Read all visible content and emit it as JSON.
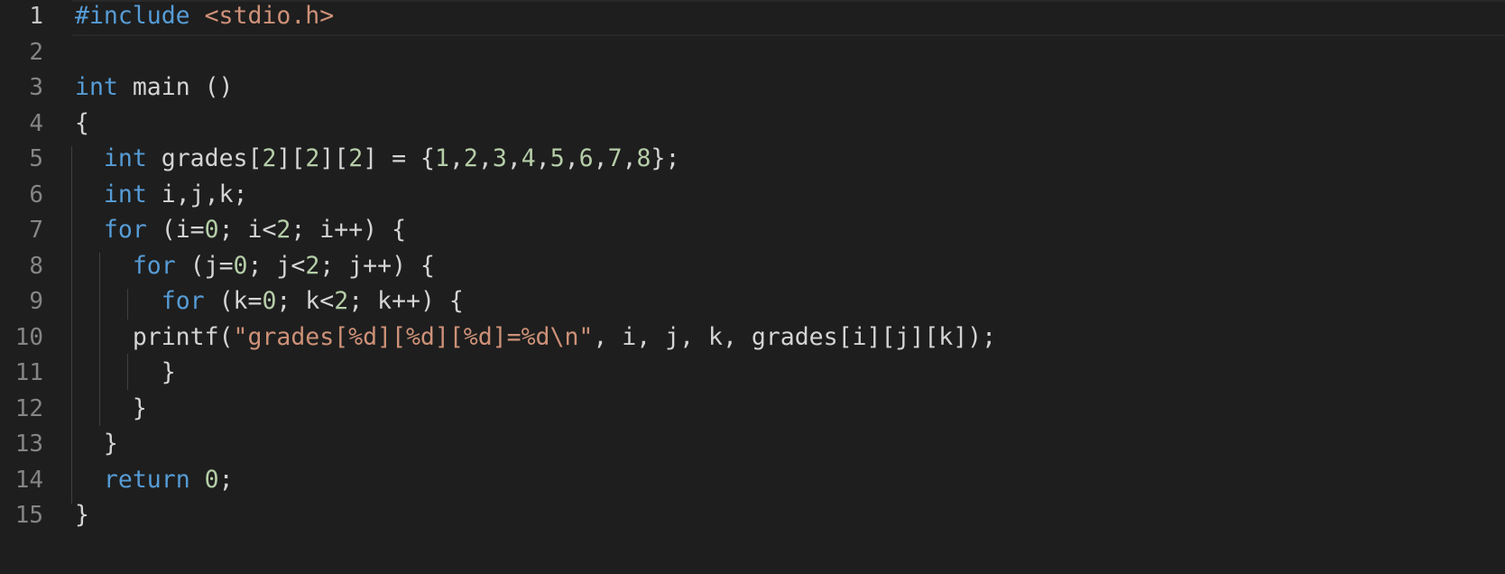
{
  "editor": {
    "lines": [
      {
        "n": "1",
        "tokens": [
          {
            "t": "#include ",
            "c": "pre"
          },
          {
            "t": "<stdio.h>",
            "c": "hdr"
          }
        ]
      },
      {
        "n": "2",
        "tokens": []
      },
      {
        "n": "3",
        "tokens": [
          {
            "t": "int",
            "c": "kw"
          },
          {
            "t": " main ()",
            "c": ""
          }
        ]
      },
      {
        "n": "4",
        "tokens": [
          {
            "t": "{",
            "c": ""
          }
        ]
      },
      {
        "n": "5",
        "tokens": [
          {
            "t": "  ",
            "c": ""
          },
          {
            "t": "int",
            "c": "kw"
          },
          {
            "t": " grades[",
            "c": ""
          },
          {
            "t": "2",
            "c": "num"
          },
          {
            "t": "][",
            "c": ""
          },
          {
            "t": "2",
            "c": "num"
          },
          {
            "t": "][",
            "c": ""
          },
          {
            "t": "2",
            "c": "num"
          },
          {
            "t": "] = {",
            "c": ""
          },
          {
            "t": "1",
            "c": "num"
          },
          {
            "t": ",",
            "c": ""
          },
          {
            "t": "2",
            "c": "num"
          },
          {
            "t": ",",
            "c": ""
          },
          {
            "t": "3",
            "c": "num"
          },
          {
            "t": ",",
            "c": ""
          },
          {
            "t": "4",
            "c": "num"
          },
          {
            "t": ",",
            "c": ""
          },
          {
            "t": "5",
            "c": "num"
          },
          {
            "t": ",",
            "c": ""
          },
          {
            "t": "6",
            "c": "num"
          },
          {
            "t": ",",
            "c": ""
          },
          {
            "t": "7",
            "c": "num"
          },
          {
            "t": ",",
            "c": ""
          },
          {
            "t": "8",
            "c": "num"
          },
          {
            "t": "};",
            "c": ""
          }
        ]
      },
      {
        "n": "6",
        "tokens": [
          {
            "t": "  ",
            "c": ""
          },
          {
            "t": "int",
            "c": "kw"
          },
          {
            "t": " i,j,k;",
            "c": ""
          }
        ]
      },
      {
        "n": "7",
        "tokens": [
          {
            "t": "  ",
            "c": ""
          },
          {
            "t": "for",
            "c": "kw"
          },
          {
            "t": " (i=",
            "c": ""
          },
          {
            "t": "0",
            "c": "num"
          },
          {
            "t": "; i<",
            "c": ""
          },
          {
            "t": "2",
            "c": "num"
          },
          {
            "t": "; i++) {",
            "c": ""
          }
        ]
      },
      {
        "n": "8",
        "tokens": [
          {
            "t": "    ",
            "c": ""
          },
          {
            "t": "for",
            "c": "kw"
          },
          {
            "t": " (j=",
            "c": ""
          },
          {
            "t": "0",
            "c": "num"
          },
          {
            "t": "; j<",
            "c": ""
          },
          {
            "t": "2",
            "c": "num"
          },
          {
            "t": "; j++) {",
            "c": ""
          }
        ]
      },
      {
        "n": "9",
        "tokens": [
          {
            "t": "      ",
            "c": ""
          },
          {
            "t": "for",
            "c": "kw"
          },
          {
            "t": " (k=",
            "c": ""
          },
          {
            "t": "0",
            "c": "num"
          },
          {
            "t": "; k<",
            "c": ""
          },
          {
            "t": "2",
            "c": "num"
          },
          {
            "t": "; k++) {",
            "c": ""
          }
        ]
      },
      {
        "n": "10",
        "tokens": [
          {
            "t": "    printf(",
            "c": ""
          },
          {
            "t": "\"grades[%d][%d][%d]=%d\\n\"",
            "c": "str"
          },
          {
            "t": ", i, j, k, grades[i][j][k]);",
            "c": ""
          }
        ]
      },
      {
        "n": "11",
        "tokens": [
          {
            "t": "      }",
            "c": ""
          }
        ]
      },
      {
        "n": "12",
        "tokens": [
          {
            "t": "    }",
            "c": ""
          }
        ]
      },
      {
        "n": "13",
        "tokens": [
          {
            "t": "  }",
            "c": ""
          }
        ]
      },
      {
        "n": "14",
        "tokens": [
          {
            "t": "  ",
            "c": ""
          },
          {
            "t": "return",
            "c": "kw"
          },
          {
            "t": " ",
            "c": ""
          },
          {
            "t": "0",
            "c": "num"
          },
          {
            "t": ";",
            "c": ""
          }
        ]
      },
      {
        "n": "15",
        "tokens": [
          {
            "t": "}",
            "c": ""
          }
        ]
      }
    ],
    "current_line": "1",
    "colors": {
      "background": "#1e1e1e",
      "keyword": "#569cd6",
      "number": "#b5cea8",
      "string": "#ce9178",
      "text": "#d4d4d4",
      "line_number": "#858585"
    }
  }
}
